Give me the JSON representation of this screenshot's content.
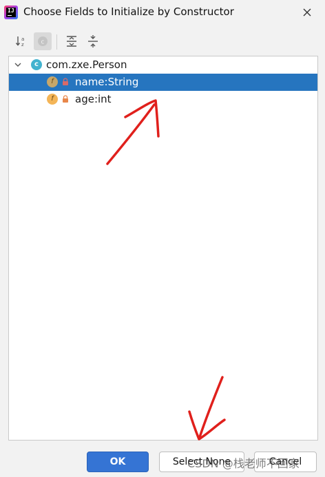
{
  "window": {
    "title": "Choose Fields to Initialize by Constructor",
    "app_logo_text": "IJ",
    "close_icon": "close-icon"
  },
  "toolbar": {
    "buttons": [
      {
        "name": "sort-alphabetically",
        "icon": "sort-az-icon",
        "active": false
      },
      {
        "name": "show-classes",
        "icon": "class-c-icon",
        "active": true
      },
      {
        "name": "expand-all",
        "icon": "expand-all-icon",
        "active": false
      },
      {
        "name": "collapse-all",
        "icon": "collapse-all-icon",
        "active": false
      }
    ]
  },
  "tree": {
    "root": {
      "label": "com.zxe.Person",
      "icon_letter": "c",
      "expanded": true
    },
    "fields": [
      {
        "label": "name:String",
        "icon_letter": "f",
        "selected": true
      },
      {
        "label": "age:int",
        "icon_letter": "f",
        "selected": false
      }
    ]
  },
  "buttons": {
    "ok": "OK",
    "select_none": "Select None",
    "cancel": "Cancel"
  },
  "watermark": "CSDN @栈老师不回家",
  "colors": {
    "selection": "#2675bf",
    "ok_button": "#3574d4",
    "annotation": "#e0201c"
  }
}
